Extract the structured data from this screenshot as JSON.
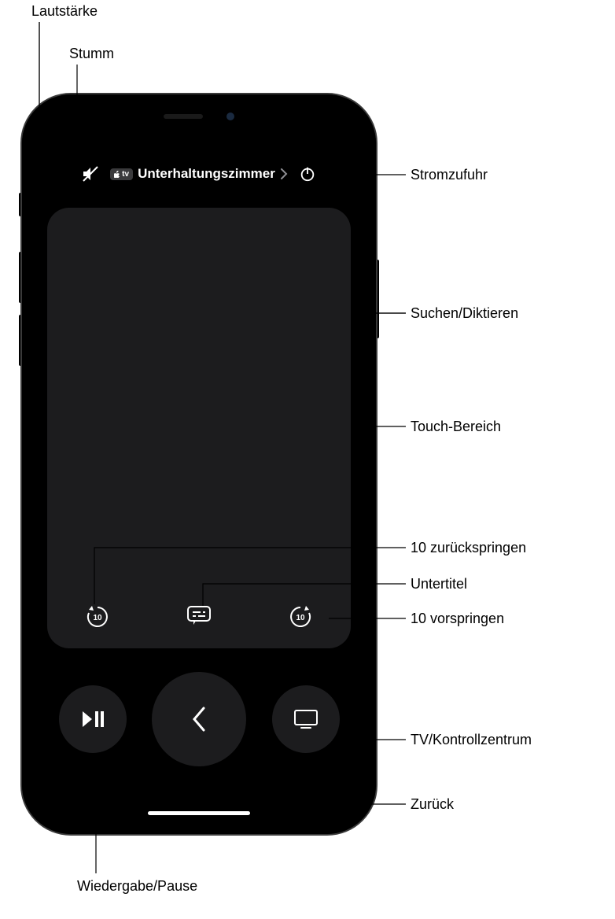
{
  "topbar": {
    "device_label": "Unterhaltungszimmer",
    "atv_badge": "tv"
  },
  "callouts": {
    "volume": "Lautstärke",
    "mute": "Stumm",
    "power": "Stromzufuhr",
    "search_dictate": "Suchen/Diktieren",
    "touch_area": "Touch-Bereich",
    "skip_back_10": "10 zurückspringen",
    "subtitles": "Untertitel",
    "skip_fwd_10": "10 vorspringen",
    "tv_control_center": "TV/Kontrollzentrum",
    "back": "Zurück",
    "play_pause": "Wiedergabe/Pause"
  }
}
